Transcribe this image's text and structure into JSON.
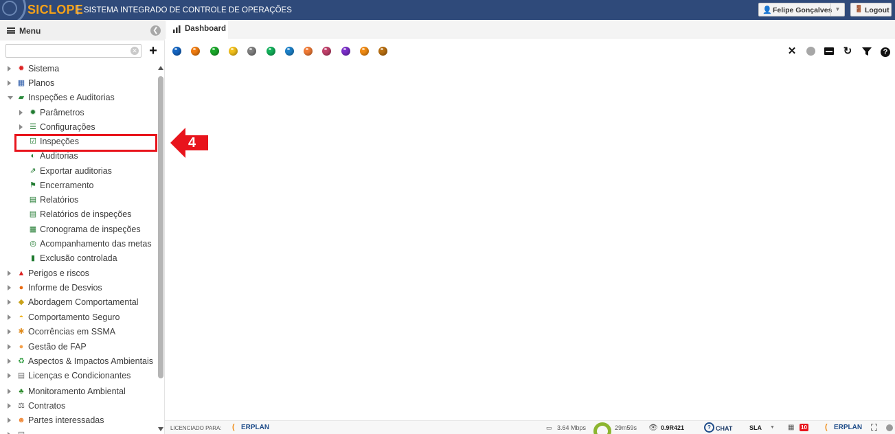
{
  "header": {
    "brand": "SICLOPE",
    "subtitle": "SISTEMA INTEGRADO DE CONTROLE DE OPERAÇÕES",
    "user_name": "Felipe Gonçalves",
    "logout_label": "Logout"
  },
  "sidebar": {
    "title": "Menu",
    "search": {
      "value": "",
      "placeholder": ""
    },
    "items": [
      {
        "label": "Sistema",
        "icon": "gear-red-icon"
      },
      {
        "label": "Planos",
        "icon": "calendar-icon"
      },
      {
        "label": "Inspeções e Auditorias",
        "icon": "folder-open-icon",
        "expanded": true
      },
      {
        "label": "Parâmetros",
        "icon": "gear-green-icon"
      },
      {
        "label": "Configurações",
        "icon": "sliders-icon"
      },
      {
        "label": "Inspeções",
        "icon": "clipboard-check-icon"
      },
      {
        "label": "Auditorias",
        "icon": "audit-icon"
      },
      {
        "label": "Exportar auditorias",
        "icon": "export-icon"
      },
      {
        "label": "Encerramento",
        "icon": "flag-icon"
      },
      {
        "label": "Relatórios",
        "icon": "pdf-icon"
      },
      {
        "label": "Relatórios de inspeções",
        "icon": "pdf-icon"
      },
      {
        "label": "Cronograma de inspeções",
        "icon": "schedule-icon"
      },
      {
        "label": "Acompanhamento das metas",
        "icon": "target-icon"
      },
      {
        "label": "Exclusão controlada",
        "icon": "trash-icon"
      },
      {
        "label": "Perigos e riscos",
        "icon": "warning-icon"
      },
      {
        "label": "Informe de Desvios",
        "icon": "report-icon"
      },
      {
        "label": "Abordagem Comportamental",
        "icon": "diamond-icon"
      },
      {
        "label": "Comportamento Seguro",
        "icon": "helmet-icon"
      },
      {
        "label": "Ocorrências em SSMA",
        "icon": "falling-person-icon"
      },
      {
        "label": "Gestão de FAP",
        "icon": "fap-icon"
      },
      {
        "label": "Aspectos & Impactos Ambientais",
        "icon": "recycle-icon"
      },
      {
        "label": "Licenças e Condicionantes",
        "icon": "document-icon"
      },
      {
        "label": "Monitoramento Ambiental",
        "icon": "tree-icon"
      },
      {
        "label": "Contratos",
        "icon": "scale-icon"
      },
      {
        "label": "Partes interessadas",
        "icon": "people-icon"
      },
      {
        "label": "",
        "icon": "document-icon"
      }
    ]
  },
  "annotation": {
    "step": "4"
  },
  "tabs": [
    {
      "label": "Dashboard",
      "icon": "bar-chart-icon"
    }
  ],
  "dashboard": {
    "balls": [
      "#1565c0",
      "#ef7b0f",
      "#1aa82a",
      "#f2c01a",
      "#7f7f7f",
      "#12b05a",
      "#1c80c8",
      "#f07a35",
      "#c0406a",
      "#7a2ec8",
      "#f08a12",
      "#b86e10"
    ],
    "tools": [
      "close-icon",
      "status-dot-icon",
      "signal-icon",
      "refresh-icon",
      "filter-icon",
      "help-icon"
    ]
  },
  "statusbar": {
    "license_label": "LICENCIADO PARA:",
    "brand_left": "ERPLAN",
    "speed": "3.64 Mbps",
    "timer": "29m59s",
    "version": "0.9R421",
    "chat": "CHAT",
    "sla": "SLA",
    "badge_count": "10",
    "brand_right": "ERPLAN"
  }
}
